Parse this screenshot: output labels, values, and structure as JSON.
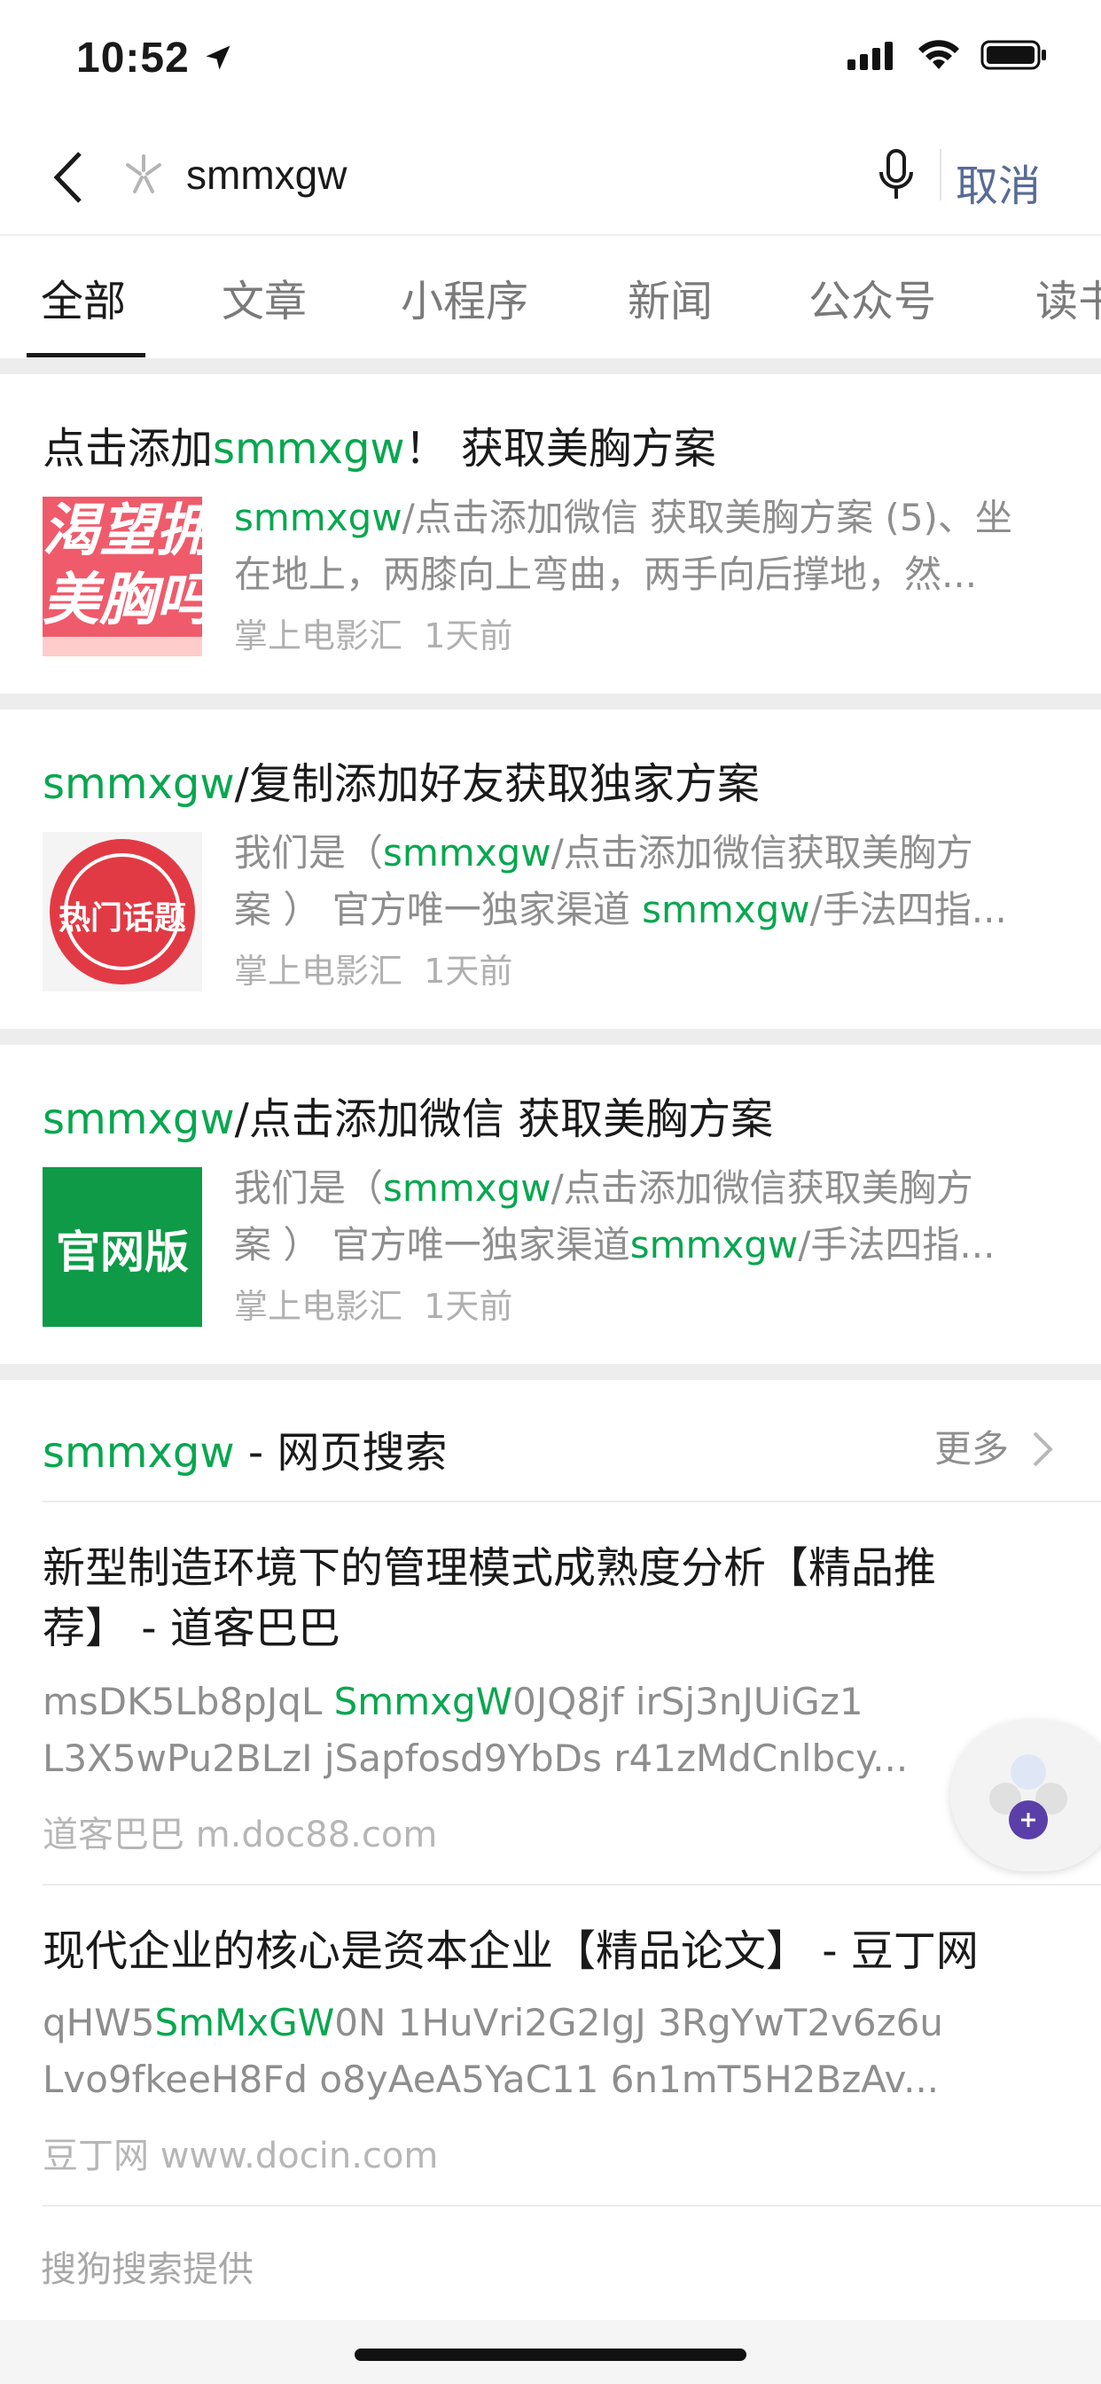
{
  "status_bar": {
    "time": "10:52"
  },
  "search": {
    "query": "smmxgw",
    "cancel_label": "取消"
  },
  "tabs": [
    {
      "label": "全部",
      "active": true
    },
    {
      "label": "文章",
      "active": false
    },
    {
      "label": "小程序",
      "active": false
    },
    {
      "label": "新闻",
      "active": false
    },
    {
      "label": "公众号",
      "active": false
    },
    {
      "label": "读书",
      "active": false
    }
  ],
  "results": [
    {
      "title_prefix": "点击添加",
      "title_highlight": "smmxgw",
      "title_suffix": "！ 获取美胸方案",
      "thumb_text_1": "渴望拥",
      "thumb_text_2": "美胸吗",
      "snippet_l1_hl": "smmxgw",
      "snippet_l1_rest": "/点击添加微信 获取美胸方案 (5)、坐",
      "snippet_l2": "在地上，两膝向上弯曲，两手向后撑地，然...",
      "source": "掌上电影汇",
      "time": "1天前"
    },
    {
      "title_highlight": "smmxgw",
      "title_suffix": "/复制添加好友获取独家方案",
      "thumb_text": "热门话题",
      "snippet_l1_pre": "我们是（",
      "snippet_l1_hl": "smmxgw",
      "snippet_l1_rest": "/点击添加微信获取美胸方",
      "snippet_l2_pre": "案 ） 官方唯一独家渠道 ",
      "snippet_l2_hl": "smmxgw",
      "snippet_l2_rest": "/手法四指...",
      "source": "掌上电影汇",
      "time": "1天前"
    },
    {
      "title_highlight": "smmxgw",
      "title_suffix": "/点击添加微信 获取美胸方案",
      "thumb_text": "官网版",
      "snippet_l1_pre": "我们是（",
      "snippet_l1_hl": "smmxgw",
      "snippet_l1_rest": "/点击添加微信获取美胸方",
      "snippet_l2_pre": "案 ） 官方唯一独家渠道",
      "snippet_l2_hl": "smmxgw",
      "snippet_l2_rest": "/手法四指...",
      "source": "掌上电影汇",
      "time": "1天前"
    }
  ],
  "web_search": {
    "header_hl": "smmxgw",
    "header_rest": " - 网页搜索",
    "more_label": "更多",
    "items": [
      {
        "title_l1": "新型制造环境下的管理模式成熟度分析【精品推",
        "title_l2": "荐】 - 道客巴巴",
        "line1_pre": "msDK5Lb8pJqL ",
        "line1_hl": "SmmxgW",
        "line1_rest": "0JQ8jf irSj3nJUiGz1",
        "line2": "L3X5wPu2BLzI jSapfosd9YbDs r41zMdCnlbcy...",
        "source": "道客巴巴 m.doc88.com"
      },
      {
        "title_l1": "现代企业的核心是资本企业【精品论文】 - 豆丁网",
        "line1_pre": "qHW5",
        "line1_hl": "SmMxGW",
        "line1_rest": "0N 1HuVri2G2IgJ 3RgYwT2v6z6u",
        "line2": "Lvo9fkeeH8Fd o8yAeA5YaC11 6n1mT5H2BzAv...",
        "source": "豆丁网 www.docin.com"
      }
    ],
    "provider": "搜狗搜索提供"
  }
}
